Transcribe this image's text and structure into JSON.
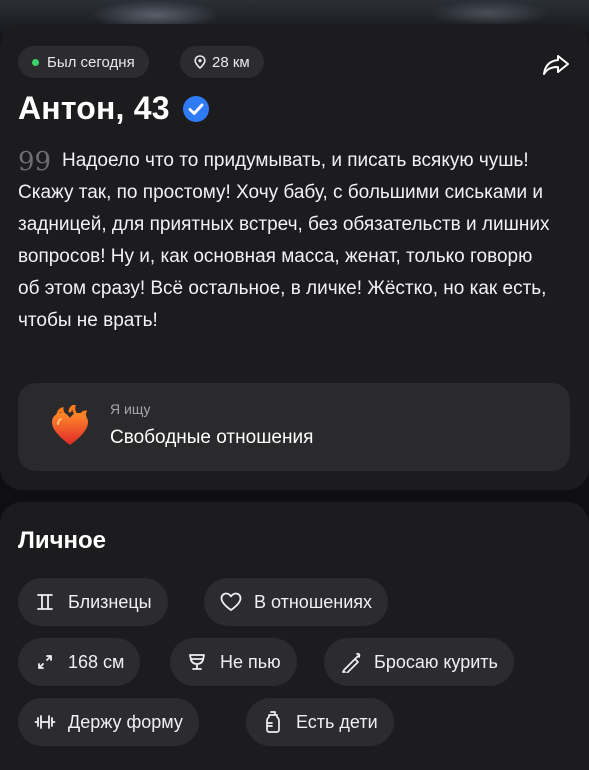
{
  "profile": {
    "status": "Был сегодня",
    "distance": "28 км",
    "name": "Антон, 43",
    "bio": "Надоело что то придумывать, и писать всякую чушь! Скажу так, по простому! Хочу бабу, с большими сиськами и задницей, для приятных встреч, без обязательств и лишних вопросов! Ну и, как основная масса, женат, только говорю об этом сразу! Всё остальное, в личке! Жёстко, но как есть, чтобы не врать!",
    "quote_mark": "99",
    "seeking": {
      "label": "Я ищу",
      "value": "Свободные отношения"
    }
  },
  "personal": {
    "title": "Личное",
    "tags": [
      {
        "label": "Близнецы",
        "icon": "gemini-icon"
      },
      {
        "label": "В отношениях",
        "icon": "heart-outline-icon"
      },
      {
        "label": "168 см",
        "icon": "height-arrows-icon"
      },
      {
        "label": "Не пью",
        "icon": "glass-icon"
      },
      {
        "label": "Бросаю курить",
        "icon": "cigarette-icon"
      },
      {
        "label": "Держу форму",
        "icon": "dumbbell-icon"
      },
      {
        "label": "Есть дети",
        "icon": "baby-bottle-icon"
      }
    ]
  },
  "colors": {
    "background": "#0f0f11",
    "card": "#1c1c1e",
    "chip": "#2c2c2e",
    "online": "#39d36a",
    "verified": "#2f7bf5"
  }
}
